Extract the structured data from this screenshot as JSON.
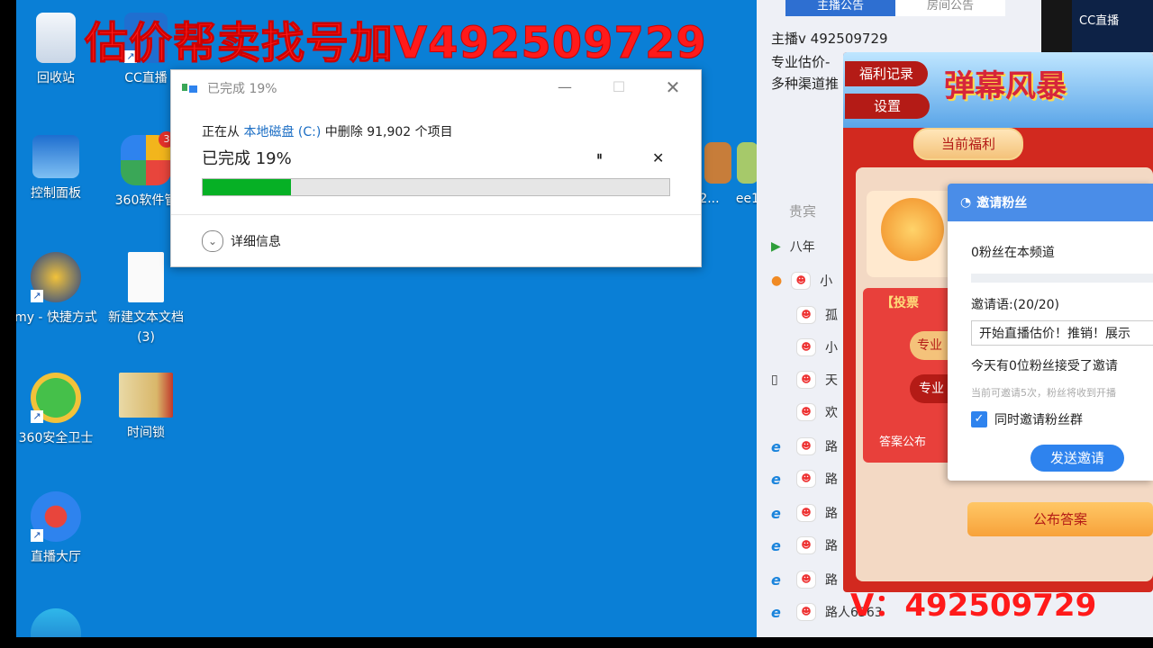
{
  "banner": {
    "text": "估价帮卖找号加V492509729",
    "bottom_text": "V：492509729"
  },
  "desktop_icons": [
    {
      "label": "回收站"
    },
    {
      "label": "CC直播"
    },
    {
      "label": "控制面板"
    },
    {
      "label": "360软件管",
      "badge": "3"
    },
    {
      "label": "my - 快捷方式"
    },
    {
      "label": "新建文本文档 (3)"
    },
    {
      "label": "360安全卫士"
    },
    {
      "label": "时间锁"
    },
    {
      "label": "直播大厅"
    },
    {
      "label": "32..."
    },
    {
      "label": "ee1"
    }
  ],
  "dialog": {
    "title": "已完成 19%",
    "line_prefix": "正在从",
    "source": "本地磁盘 (C:)",
    "line_suffix": "中删除 91,902 个项目",
    "percent_text": "已完成 19%",
    "progress": 0.19,
    "details": "详细信息",
    "pause_glyph": "⏸",
    "cancel_glyph": "✕"
  },
  "right_panel": {
    "tabs": [
      "主播公告",
      "房间公告"
    ],
    "notice": [
      "主播v 492509729",
      "专业估价-",
      "多种渠道推"
    ],
    "list_tab": "贵宾",
    "list": [
      {
        "name": "八年"
      },
      {
        "name": "小"
      },
      {
        "name": "孤"
      },
      {
        "name": "小"
      },
      {
        "name": "天"
      },
      {
        "name": "欢"
      },
      {
        "name": "路"
      },
      {
        "name": "路"
      },
      {
        "name": "路"
      },
      {
        "name": "路"
      },
      {
        "name": "路"
      },
      {
        "name": "路人6363"
      }
    ]
  },
  "gift_panel": {
    "btn_records": "福利记录",
    "btn_settings": "设置",
    "banner_title": "弹幕风暴",
    "current_benefit": "当前福利",
    "vote_label": "【投票",
    "answer_label": "答案公布",
    "pro1": "专业",
    "pro2": "专业",
    "publish_answer": "公布答案"
  },
  "invite": {
    "header": "邀请粉丝",
    "fans_line": "0粉丝在本频道",
    "invite_label": "邀请语:(20/20)",
    "invite_text": "开始直播估价！推销！展示",
    "today_line": "今天有0位粉丝接受了邀请",
    "hint": "当前可邀请5次，粉丝将收到开播",
    "checkbox_label": "同时邀请粉丝群",
    "send_button": "发送邀请"
  },
  "top_right_logo": "CC直播"
}
